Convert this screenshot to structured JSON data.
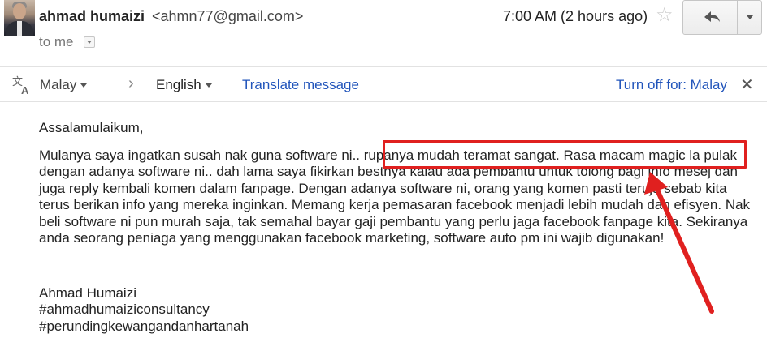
{
  "header": {
    "sender_name": "ahmad humaizi",
    "sender_email": "<ahmn77@gmail.com>",
    "recipient": "to me",
    "timestamp": "7:00 AM (2 hours ago)"
  },
  "translate_bar": {
    "source_language": "Malay",
    "target_language": "English",
    "translate_link": "Translate message",
    "turn_off_link": "Turn off for: Malay"
  },
  "message": {
    "greeting": "Assalamulaikum,",
    "body": "Mulanya saya ingatkan susah nak guna software ni.. rupanya mudah teramat sangat. Rasa macam magic la pulak dengan adanya software ni.. dah lama saya fikirkan bestnya kalau ada pembantu untuk tolong bagi info mesej dan juga reply kembali komen dalam fanpage. Dengan adanya software ni, orang yang komen pasti teruja sebab kita terus berikan info yang mereka inginkan. Memang kerja pemasaran facebook menjadi lebih mudah dan efisyen. Nak beli software ni pun murah saja, tak semahal bayar gaji pembantu yang perlu jaga facebook fanpage kita. Sekiranya anda seorang peniaga yang menggunakan facebook marketing, software auto pm ini wajib digunakan!",
    "signature_name": "Ahmad Humaizi",
    "hashtag_1": "#ahmadhumaiziconsultancy",
    "hashtag_2": "#perundingkewangandanhartanah"
  },
  "icons": {
    "star": "star-outline-icon",
    "reply": "reply-arrow-icon",
    "more": "dropdown-caret-icon",
    "translate": "translate-icon",
    "close": "close-icon"
  },
  "colors": {
    "link": "#2255bb",
    "annotation": "#e0201f"
  }
}
